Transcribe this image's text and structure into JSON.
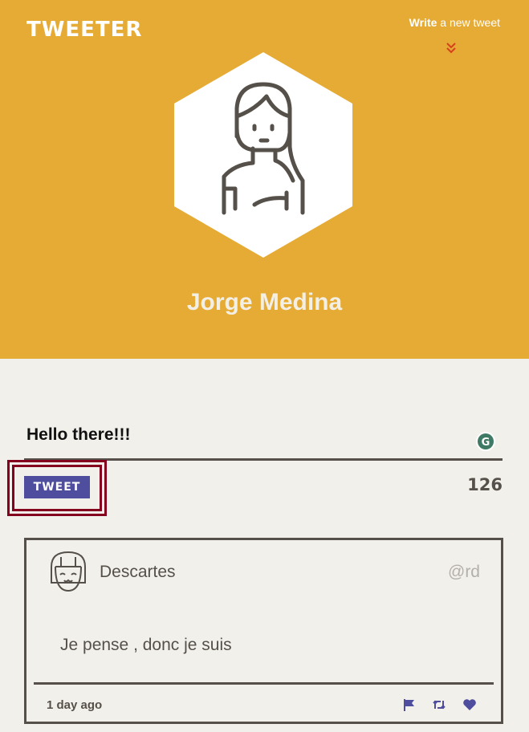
{
  "header": {
    "logo": "TWEETER",
    "write_bold": "Write",
    "write_rest": " a new tweet",
    "user_name": "Jorge Medina"
  },
  "composer": {
    "text": "Hello there!!!",
    "button_label": "TWEET",
    "char_count": "126"
  },
  "tweets": [
    {
      "author": "Descartes",
      "handle": "@rd",
      "content": "Je pense , donc je suis",
      "time": "1 day ago"
    }
  ],
  "colors": {
    "header_bg": "#e6ab35",
    "accent": "#4f4d9e",
    "highlight": "#85001e"
  }
}
